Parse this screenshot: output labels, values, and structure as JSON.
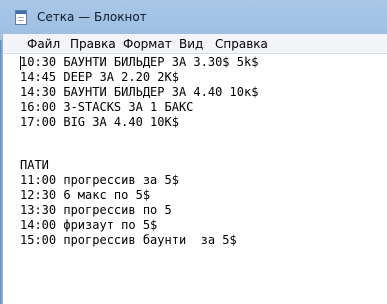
{
  "window": {
    "title": "Сетка — Блокнот"
  },
  "menubar": {
    "items": [
      "Файл",
      "Правка",
      "Формат",
      "Вид",
      "Справка"
    ]
  },
  "editor": {
    "lines": [
      "10:30 БАУНТИ БИЛЬДЕР ЗА 3.30$ 5k$",
      "14:45 DEEP ЗА 2.20 2K$",
      "14:30 БАУНТИ БИЛЬДЕР ЗА 4.40 10к$",
      "16:00 3-STACKS ЗА 1 БАКС",
      "17:00 BIG ЗА 4.40 10К$",
      "",
      "",
      "",
      "ПАТИ",
      "11:00 прогрессив за 5$",
      "12:30 6 макс по 5$",
      "13:30 прогрессив по 5",
      "14:00 фризаут по 5$",
      "15:00 прогрессив баунти  за 5$"
    ]
  },
  "icons": {
    "app": "notepad-icon"
  }
}
